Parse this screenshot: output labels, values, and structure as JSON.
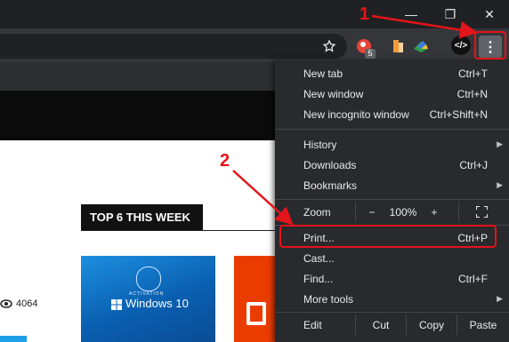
{
  "window": {
    "minimize_icon": "minimize-icon",
    "restore_icon": "restore-icon",
    "close_icon": "close-icon",
    "minimize_glyph": "—",
    "restore_glyph": "❐",
    "close_glyph": "✕"
  },
  "toolbar": {
    "bookmark_icon": "star-icon",
    "extension_badge": "5",
    "devtools_glyph": "</>",
    "menu_glyph": "⋮"
  },
  "page": {
    "top6_heading": "TOP 6 THIS WEEK",
    "view_count": "4064",
    "thumb1_title": "Windows 10",
    "thumb1_badge": "ACTIVATION"
  },
  "menu": {
    "new_tab": {
      "label": "New tab",
      "shortcut": "Ctrl+T"
    },
    "new_window": {
      "label": "New window",
      "shortcut": "Ctrl+N"
    },
    "new_incognito": {
      "label": "New incognito window",
      "shortcut": "Ctrl+Shift+N"
    },
    "history": {
      "label": "History"
    },
    "downloads": {
      "label": "Downloads",
      "shortcut": "Ctrl+J"
    },
    "bookmarks": {
      "label": "Bookmarks"
    },
    "zoom": {
      "label": "Zoom",
      "minus": "−",
      "value": "100%",
      "plus": "+"
    },
    "print": {
      "label": "Print...",
      "shortcut": "Ctrl+P"
    },
    "cast": {
      "label": "Cast..."
    },
    "find": {
      "label": "Find...",
      "shortcut": "Ctrl+F"
    },
    "more_tools": {
      "label": "More tools"
    },
    "edit": {
      "label": "Edit",
      "cut": "Cut",
      "copy": "Copy",
      "paste": "Paste"
    }
  },
  "annotations": {
    "step1": "1",
    "step2": "2",
    "color": "#e3141a"
  }
}
